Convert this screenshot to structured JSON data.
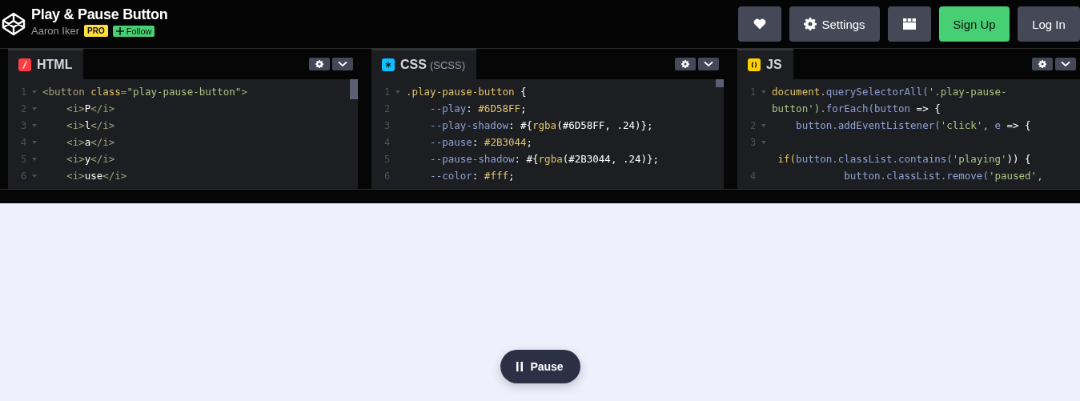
{
  "header": {
    "title": "Play & Pause Button",
    "author": "Aaron Iker",
    "badge": "PRO",
    "follow_button": "Follow",
    "buttons": [
      {
        "kind": "heart"
      },
      {
        "kind": "settings",
        "label": "Settings"
      },
      {
        "kind": "layout"
      },
      {
        "kind": "signup",
        "label": "Sign Up"
      },
      {
        "kind": "login",
        "label": "Log In"
      }
    ]
  },
  "editors": [
    {
      "kind": "html",
      "title": "HTML",
      "lines": [
        {
          "number": "1",
          "fold": true,
          "tokens": [
            {
              "kind": "tag",
              "text": "<button "
            },
            {
              "kind": "attr",
              "text": "class"
            },
            {
              "kind": "tag",
              "text": "="
            },
            {
              "kind": "string",
              "text": "\"play-pause-button\""
            },
            {
              "kind": "tag",
              "text": ">"
            }
          ]
        },
        {
          "number": "2",
          "fold": true,
          "tokens": [
            {
              "kind": "tag",
              "text": "    <i>"
            },
            {
              "kind": "text",
              "text": "P"
            },
            {
              "kind": "tag",
              "text": "</i>"
            }
          ]
        },
        {
          "number": "3",
          "fold": true,
          "tokens": [
            {
              "kind": "tag",
              "text": "    <i>"
            },
            {
              "kind": "text",
              "text": "l"
            },
            {
              "kind": "tag",
              "text": "</i>"
            }
          ]
        },
        {
          "number": "4",
          "fold": true,
          "tokens": [
            {
              "kind": "tag",
              "text": "    <i>"
            },
            {
              "kind": "text",
              "text": "a"
            },
            {
              "kind": "tag",
              "text": "</i>"
            }
          ]
        },
        {
          "number": "5",
          "fold": true,
          "tokens": [
            {
              "kind": "tag",
              "text": "    <i>"
            },
            {
              "kind": "text",
              "text": "y"
            },
            {
              "kind": "tag",
              "text": "</i>"
            }
          ]
        },
        {
          "number": "6",
          "fold": true,
          "tokens": [
            {
              "kind": "tag",
              "text": "    <i>"
            },
            {
              "kind": "text",
              "text": "use"
            },
            {
              "kind": "tag",
              "text": "</i>"
            }
          ]
        }
      ]
    },
    {
      "kind": "css",
      "title": "CSS",
      "subtitle": "(SCSS)",
      "lines": [
        {
          "number": "1",
          "fold": true,
          "tokens": [
            {
              "kind": "attr",
              "text": ".play-pause-button"
            },
            {
              "kind": "text",
              "text": " {"
            }
          ]
        },
        {
          "number": "2",
          "fold": false,
          "tokens": [
            {
              "kind": "prop",
              "text": "    --play"
            },
            {
              "kind": "text",
              "text": ": "
            },
            {
              "kind": "attr",
              "text": "#6D58FF"
            },
            {
              "kind": "text",
              "text": ";"
            }
          ]
        },
        {
          "number": "3",
          "fold": false,
          "tokens": [
            {
              "kind": "prop",
              "text": "    --play-shadow"
            },
            {
              "kind": "text",
              "text": ": #{"
            },
            {
              "kind": "attr",
              "text": "rgba"
            },
            {
              "kind": "text",
              "text": "(#6D58FF, .24)};"
            }
          ]
        },
        {
          "number": "4",
          "fold": false,
          "tokens": [
            {
              "kind": "prop",
              "text": "    --pause"
            },
            {
              "kind": "text",
              "text": ": "
            },
            {
              "kind": "attr",
              "text": "#2B3044"
            },
            {
              "kind": "text",
              "text": ";"
            }
          ]
        },
        {
          "number": "5",
          "fold": false,
          "tokens": [
            {
              "kind": "prop",
              "text": "    --pause-shadow"
            },
            {
              "kind": "text",
              "text": ": #{"
            },
            {
              "kind": "attr",
              "text": "rgba"
            },
            {
              "kind": "text",
              "text": "(#2B3044, .24)};"
            }
          ]
        },
        {
          "number": "6",
          "fold": false,
          "tokens": [
            {
              "kind": "prop",
              "text": "    --color"
            },
            {
              "kind": "text",
              "text": ": "
            },
            {
              "kind": "attr",
              "text": "#fff"
            },
            {
              "kind": "text",
              "text": ";"
            }
          ]
        }
      ]
    },
    {
      "kind": "js",
      "title": "JS",
      "lines": [
        {
          "number": "1",
          "fold": true,
          "tokens": [
            {
              "kind": "attr",
              "text": "document."
            },
            {
              "kind": "prop",
              "text": "querySelectorAll("
            },
            {
              "kind": "string",
              "text": "'.play-pause-"
            }
          ]
        },
        {
          "tokens": [
            {
              "kind": "string",
              "text": "button')."
            },
            {
              "kind": "prop",
              "text": "forEach(button"
            },
            {
              "kind": "text",
              "text": " => {"
            }
          ]
        },
        {
          "number": "2",
          "fold": true,
          "tokens": [
            {
              "kind": "prop",
              "text": "    button.addEventListener("
            },
            {
              "kind": "string",
              "text": "'click',"
            },
            {
              "kind": "prop",
              "text": " e"
            },
            {
              "kind": "text",
              "text": " => {"
            }
          ]
        },
        {
          "number": "3",
          "fold": true
        },
        {
          "tokens": [
            {
              "kind": "attr",
              "text": " if("
            },
            {
              "kind": "prop",
              "text": "button.classList.contains("
            },
            {
              "kind": "string",
              "text": "'playing'"
            },
            {
              "kind": "text",
              "text": ")) {"
            }
          ]
        },
        {
          "number": "4",
          "fold": false,
          "tokens": [
            {
              "kind": "prop",
              "text": "            button.classList.remove("
            },
            {
              "kind": "string",
              "text": "'paused',"
            }
          ]
        }
      ]
    }
  ],
  "preview": {
    "button": {
      "label": "Pause",
      "kind": "pause"
    }
  }
}
